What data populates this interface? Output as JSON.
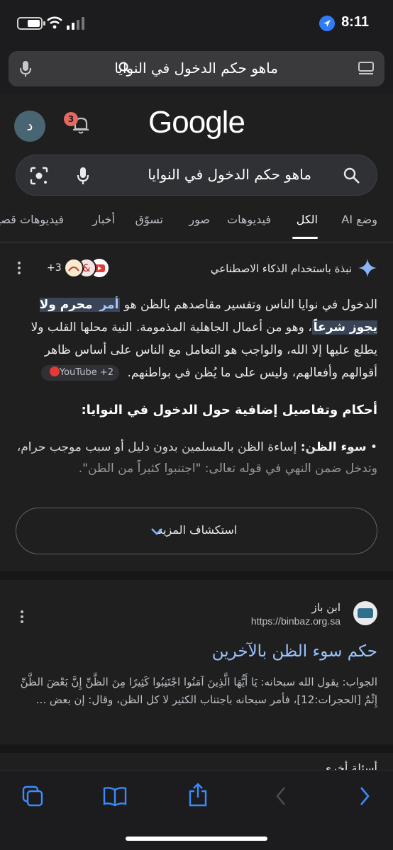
{
  "status_bar": {
    "time": "8:11",
    "battery_percent": 60
  },
  "browser": {
    "url_text": "ماهو حكم الدخول في النوايا",
    "reader_icon": "reader-icon",
    "mic_icon": "mic-icon"
  },
  "google": {
    "logo": "Google",
    "avatar_letter": "د",
    "notification_count": "3",
    "search_value": "ماهو حكم الدخول في النوايا",
    "tabs": [
      "وضع AI",
      "الكل",
      "فيديوهات",
      "صور",
      "تسوّق",
      "أخبار",
      "فيديوهات قصيرة"
    ],
    "active_tab": "الكل"
  },
  "ai_overview": {
    "title": "نبذة باستخدام الذكاء الاصطناعي",
    "source_count": "+3",
    "para_pre": "الدخول في نوايا الناس وتفسير مقاصدهم بالظن هو ",
    "para_hl1": "أمر ",
    "para_hl2": "محرم ولا يجوز شرعاً",
    "para_post": "، وهو من أعمال الجاهلية المذمومة. النية محلها القلب ولا يطلع عليها إلا الله، والواجب هو التعامل مع الناس على أساس ظاهر أقوالهم وأفعالهم، وليس على ما يُظن في بواطنهم.",
    "source_chip": "YouTube +2",
    "subheading": "أحكام وتفاصيل إضافية حول الدخول في النوايا:",
    "bullet_term": "سوء الظن:",
    "bullet_text": " إساءة الظن بالمسلمين بدون دليل أو سبب موجب حرام، وتدخل ضمن النهي في قوله تعالى: \"اجتنبوا كثيراً من الظن\".",
    "explore_label": "استكشاف المزيد"
  },
  "result": {
    "site_name": "ابن باز",
    "site_url": "https://binbaz.org.sa",
    "title": "حكم سوء الظن بالآخرين",
    "snippet": "الجواب: يقول الله سبحانه: يَا أَيُّهَا الَّذِينَ آمَنُوا اجْتَنِبُوا كَثِيرًا مِنَ الظَّنِّ إِنَّ بَعْضَ الظَّنِّ إِثْمٌ [الحجرات:12]، فأمر سبحانه باجتناب الكثير لا كل الظن، وقال: إن بعض ..."
  },
  "next_result_peek": "أسئلة أخرى",
  "toolbar": {
    "icons": [
      "tabs-icon",
      "bookmarks-icon",
      "share-icon",
      "back-icon",
      "forward-icon"
    ]
  },
  "colors": {
    "accent": "#8ab4f8",
    "link": "#99c3ff",
    "highlight": "#394457",
    "background": "#1f1f1f"
  }
}
